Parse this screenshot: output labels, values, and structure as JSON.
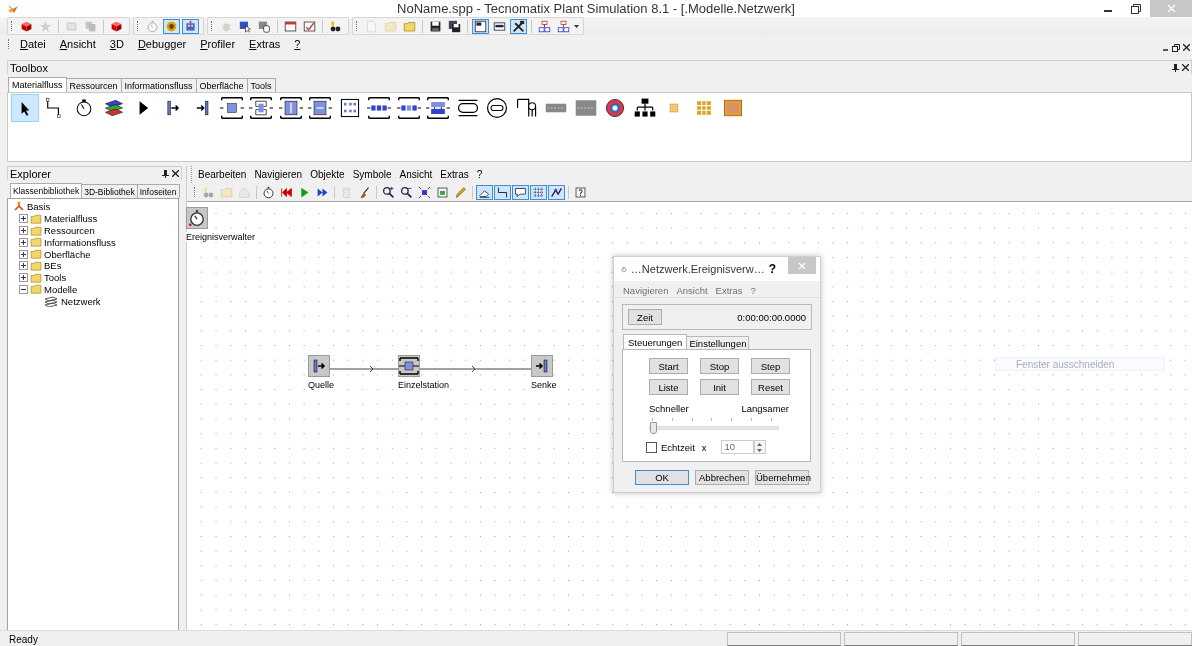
{
  "window": {
    "title": "NoName.spp - Tecnomatix Plant Simulation 8.1 - [.Modelle.Netzwerk]"
  },
  "main_toolbar": {
    "groups": [
      [
        {
          "selected": false,
          "disabled": false
        },
        {
          "selected": false,
          "disabled": true
        },
        {
          "selected": false,
          "disabled": true
        },
        {
          "selected": false,
          "disabled": true
        },
        {
          "selected": false,
          "disabled": false
        }
      ],
      [
        {
          "selected": false,
          "disabled": true
        },
        {
          "selected": true,
          "disabled": false
        },
        {
          "selected": true,
          "disabled": false
        }
      ],
      [
        {
          "selected": false,
          "disabled": true
        },
        {
          "selected": false,
          "disabled": false
        },
        {
          "selected": false,
          "disabled": false
        },
        {
          "selected": false,
          "disabled": false
        },
        {
          "selected": false,
          "disabled": false
        },
        {
          "selected": false,
          "disabled": false
        }
      ],
      [
        {
          "selected": false,
          "disabled": true
        },
        {
          "selected": false,
          "disabled": true
        },
        {
          "selected": false,
          "disabled": false
        },
        {
          "selected": false,
          "disabled": false
        },
        {
          "selected": false,
          "disabled": false
        },
        {
          "selected": true,
          "disabled": false
        },
        {
          "selected": false,
          "disabled": false
        },
        {
          "selected": true,
          "disabled": false
        },
        {
          "selected": false,
          "disabled": false
        },
        {
          "selected": false,
          "disabled": false
        }
      ]
    ]
  },
  "menu": [
    "Datei",
    "Ansicht",
    "3D",
    "Debugger",
    "Profiler",
    "Extras",
    "?"
  ],
  "toolbox": {
    "title": "Toolbox",
    "tabs": [
      {
        "label": "Materialfluss",
        "selected": true
      },
      {
        "label": "Ressourcen",
        "selected": false
      },
      {
        "label": "Informationsfluss",
        "selected": false
      },
      {
        "label": "Oberfläche",
        "selected": false
      },
      {
        "label": "Tools",
        "selected": false
      }
    ],
    "tools": [
      {
        "selected": true
      },
      {
        "selected": false
      },
      {
        "selected": false
      },
      {
        "selected": false
      },
      {
        "selected": false
      },
      {
        "selected": false
      },
      {
        "selected": false
      },
      {
        "selected": false
      },
      {
        "selected": false
      },
      {
        "selected": false
      },
      {
        "selected": false
      },
      {
        "selected": false
      },
      {
        "selected": false
      },
      {
        "selected": false
      },
      {
        "selected": false
      },
      {
        "selected": false
      },
      {
        "selected": false
      },
      {
        "selected": false
      },
      {
        "selected": false
      },
      {
        "selected": false
      },
      {
        "selected": false
      },
      {
        "selected": false
      },
      {
        "selected": false
      },
      {
        "selected": false
      },
      {
        "selected": false
      }
    ]
  },
  "explorer": {
    "title": "Explorer",
    "tabs": [
      {
        "label": "Klassenbibliothek",
        "selected": true
      },
      {
        "label": "3D-Bibliothek",
        "selected": false
      },
      {
        "label": "Infoseiten",
        "selected": false
      }
    ],
    "tree": [
      {
        "label": "Basis",
        "kind": "root",
        "children": [
          {
            "label": "Materialfluss",
            "kind": "folder",
            "expanded": false
          },
          {
            "label": "Ressourcen",
            "kind": "folder",
            "expanded": false
          },
          {
            "label": "Informationsfluss",
            "kind": "folder",
            "expanded": false
          },
          {
            "label": "Oberfläche",
            "kind": "folder",
            "expanded": false
          },
          {
            "label": "BEs",
            "kind": "folder",
            "expanded": false
          },
          {
            "label": "Tools",
            "kind": "folder",
            "expanded": false
          },
          {
            "label": "Modelle",
            "kind": "folder",
            "expanded": true,
            "children": [
              {
                "label": "Netzwerk",
                "kind": "network"
              }
            ]
          }
        ]
      }
    ]
  },
  "network": {
    "menu": [
      "Bearbeiten",
      "Navigieren",
      "Objekte",
      "Symbole",
      "Ansicht",
      "Extras",
      "?"
    ],
    "toolbar": [
      {
        "selected": false,
        "disabled": true
      },
      {
        "selected": false,
        "disabled": true
      },
      {
        "selected": false,
        "disabled": true
      },
      {
        "selected": false,
        "disabled": false
      },
      {
        "selected": false,
        "disabled": false
      },
      {
        "selected": false,
        "disabled": false
      },
      {
        "selected": false,
        "disabled": false
      },
      {
        "selected": false,
        "disabled": true
      },
      {
        "selected": false,
        "disabled": false
      },
      {
        "selected": false,
        "disabled": false
      },
      {
        "selected": false,
        "disabled": false
      },
      {
        "selected": false,
        "disabled": false
      },
      {
        "selected": false,
        "disabled": false
      },
      {
        "selected": false,
        "disabled": false
      },
      {
        "selected": true,
        "disabled": false
      },
      {
        "selected": true,
        "disabled": false
      },
      {
        "selected": true,
        "disabled": false
      },
      {
        "selected": true,
        "disabled": false
      },
      {
        "selected": true,
        "disabled": false
      },
      {
        "selected": false,
        "disabled": false
      }
    ],
    "objects": [
      {
        "label": "Ereignisverwalter",
        "kind": "eventcontroller"
      },
      {
        "label": "Quelle",
        "kind": "source"
      },
      {
        "label": "Einzelstation",
        "kind": "station"
      },
      {
        "label": "Senke",
        "kind": "sink"
      }
    ],
    "ghost_label": "Fenster ausschneiden"
  },
  "dialog": {
    "title": "…Netzwerk.Ereignisverw…",
    "help": "?",
    "menu": [
      "Navigieren",
      "Ansicht",
      "Extras",
      "?"
    ],
    "time_button": "Zeit",
    "time": "0:00:00:00.0000",
    "tabs": [
      {
        "label": "Steuerungen",
        "selected": true
      },
      {
        "label": "Einstellungen",
        "selected": false
      }
    ],
    "buttons": [
      "Start",
      "Stop",
      "Step",
      "Liste",
      "Init",
      "Reset"
    ],
    "slider": {
      "left_label": "Schneller",
      "right_label": "Langsamer",
      "level": 0
    },
    "realtime": {
      "label": "Echtzeit",
      "checked": false,
      "factor_label": "x",
      "value": "10"
    },
    "footer_buttons": [
      {
        "label": "OK",
        "default": true
      },
      {
        "label": "Abbrechen",
        "default": false
      },
      {
        "label": "Übernehmen",
        "default": false
      }
    ]
  },
  "status_bar": {
    "text": "Ready"
  }
}
